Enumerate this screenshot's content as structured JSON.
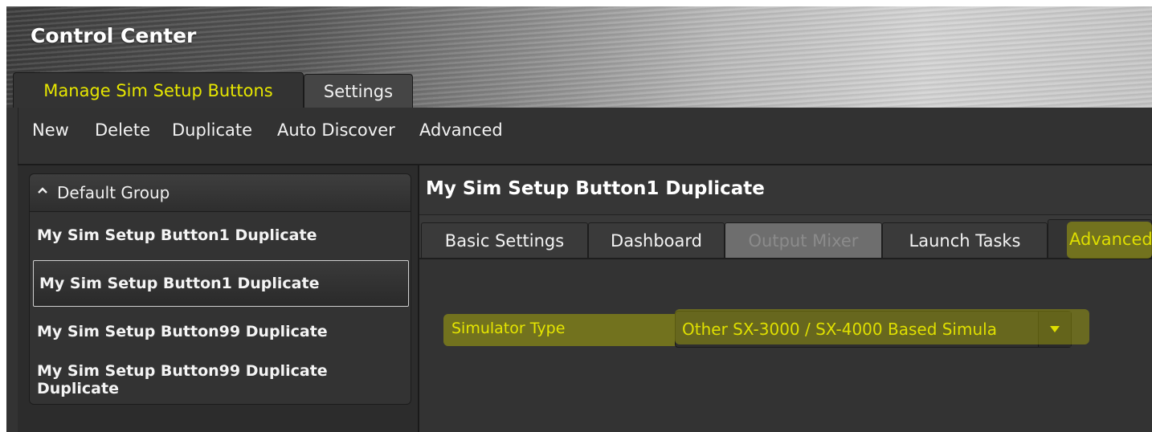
{
  "app": {
    "title": "Control Center"
  },
  "top_tabs": [
    {
      "label": "Manage Sim Setup Buttons",
      "active": true
    },
    {
      "label": "Settings",
      "active": false
    }
  ],
  "toolbar": {
    "items": [
      "New",
      "Delete",
      "Duplicate",
      "Auto Discover",
      "Advanced"
    ]
  },
  "group": {
    "name": "Default Group",
    "expanded": true,
    "items": [
      {
        "label": "My Sim Setup Button1 Duplicate",
        "selected": false
      },
      {
        "label": "My Sim Setup Button1 Duplicate",
        "selected": true
      },
      {
        "label": "My Sim Setup Button99 Duplicate",
        "selected": false
      },
      {
        "label": "My Sim Setup Button99 Duplicate Duplicate",
        "selected": false
      }
    ]
  },
  "detail": {
    "title": "My Sim Setup Button1 Duplicate",
    "tabs": [
      {
        "label": "Basic Settings",
        "state": "normal"
      },
      {
        "label": "Dashboard",
        "state": "normal"
      },
      {
        "label": "Output Mixer",
        "state": "disabled"
      },
      {
        "label": "Launch Tasks",
        "state": "normal"
      },
      {
        "label": "Advanced",
        "state": "active"
      }
    ],
    "simulator_type": {
      "label": "Simulator Type",
      "value": "Other SX-3000 / SX-4000 Based Simula"
    }
  },
  "icons": {
    "group_toggle": "chevron-up-icon",
    "dropdown": "triangle-down-icon"
  },
  "colors": {
    "accent_yellow": "#e6e600",
    "highlight": "#d2d200",
    "panel": "#333333"
  }
}
